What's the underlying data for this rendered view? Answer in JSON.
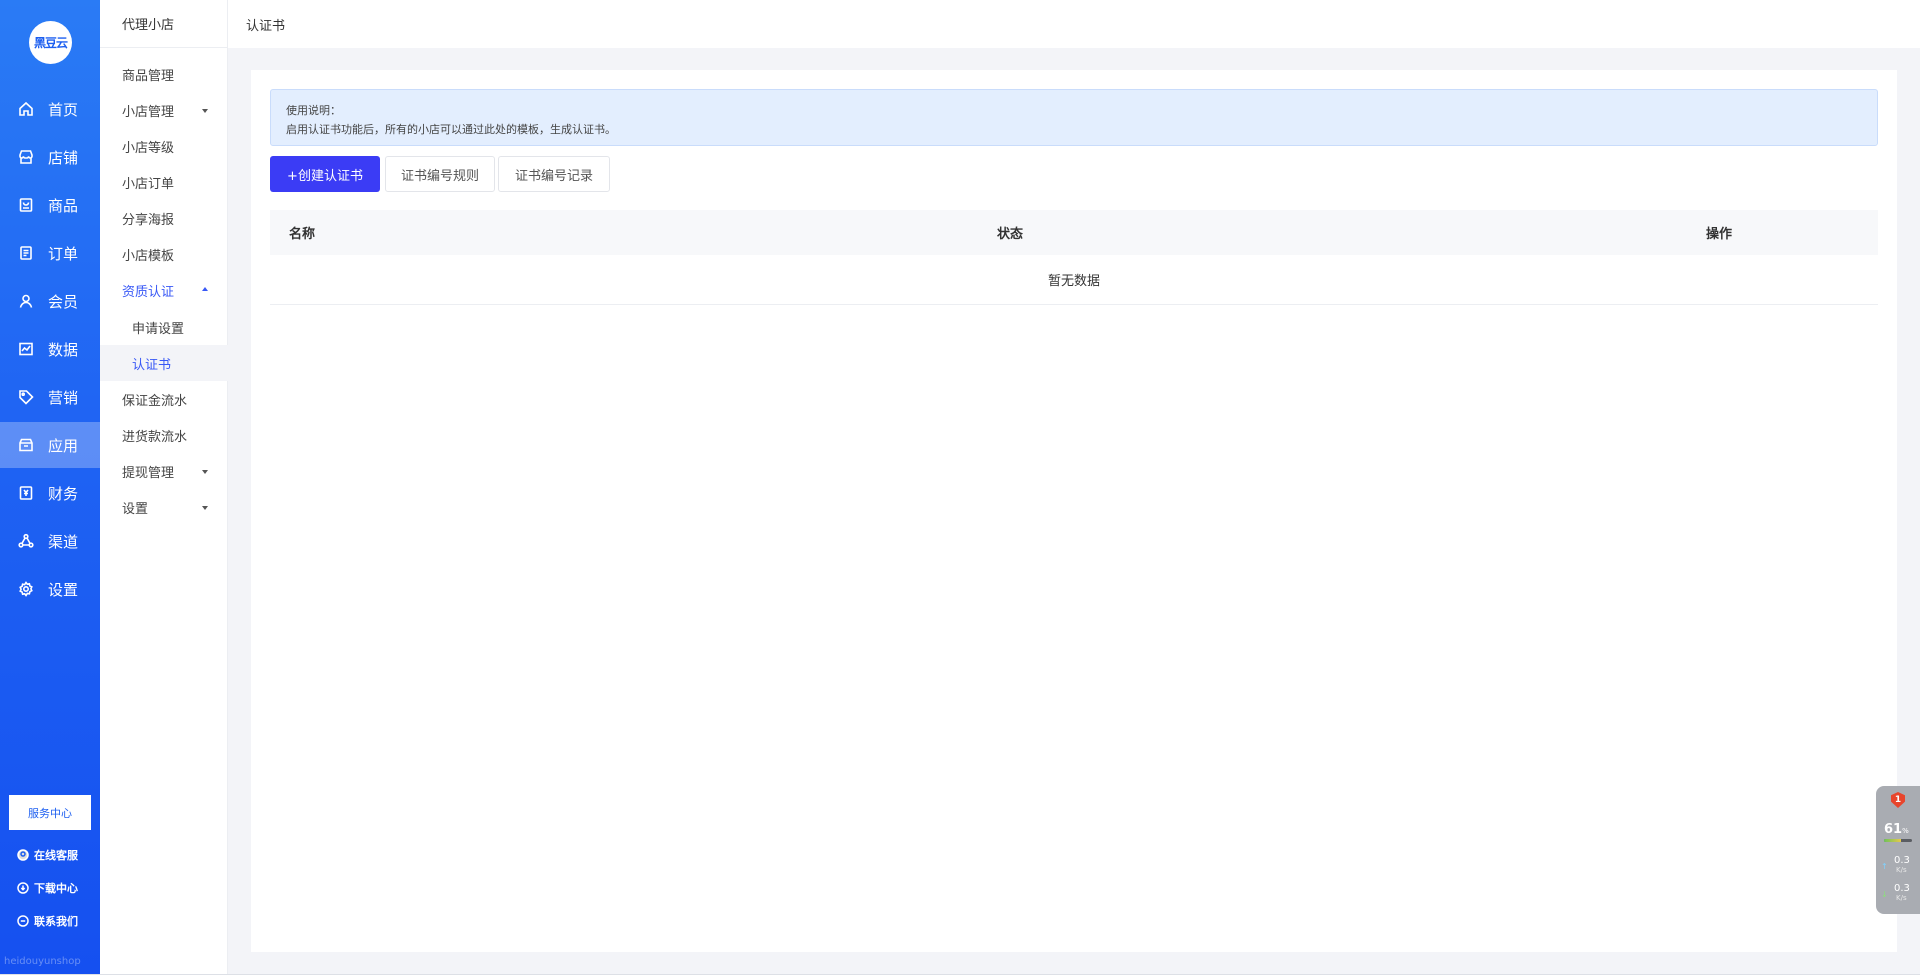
{
  "primary_nav": {
    "logo_text": "黑豆云",
    "items": [
      {
        "label": "首页",
        "icon": "home-icon"
      },
      {
        "label": "店铺",
        "icon": "shop-icon"
      },
      {
        "label": "商品",
        "icon": "goods-icon"
      },
      {
        "label": "订单",
        "icon": "order-icon"
      },
      {
        "label": "会员",
        "icon": "member-icon"
      },
      {
        "label": "数据",
        "icon": "chart-icon"
      },
      {
        "label": "营销",
        "icon": "tag-icon"
      },
      {
        "label": "应用",
        "icon": "app-icon"
      },
      {
        "label": "财务",
        "icon": "finance-icon"
      },
      {
        "label": "渠道",
        "icon": "channel-icon"
      },
      {
        "label": "设置",
        "icon": "settings-icon"
      }
    ],
    "active": "应用",
    "service_center": "服务中心",
    "footer_links": [
      "在线客服",
      "下载中心",
      "联系我们"
    ],
    "watermark": "heidouyunshop"
  },
  "secondary_nav": {
    "title": "代理小店",
    "items": [
      {
        "label": "商品管理"
      },
      {
        "label": "小店管理",
        "caret": "down"
      },
      {
        "label": "小店等级"
      },
      {
        "label": "小店订单"
      },
      {
        "label": "分享海报"
      },
      {
        "label": "小店模板"
      },
      {
        "label": "资质认证",
        "caret": "up",
        "state": "open"
      },
      {
        "label": "申请设置",
        "sub": true
      },
      {
        "label": "认证书",
        "sub": true,
        "state": "current"
      },
      {
        "label": "保证金流水"
      },
      {
        "label": "进货款流水"
      },
      {
        "label": "提现管理",
        "caret": "down"
      },
      {
        "label": "设置",
        "caret": "down"
      }
    ]
  },
  "header": {
    "breadcrumb": "认证书"
  },
  "notice": {
    "title": "使用说明：",
    "body": "启用认证书功能后，所有的小店可以通过此处的模板，生成认证书。"
  },
  "toolbar": {
    "create_label": "+创建认证书",
    "rule_label": "证书编号规则",
    "record_label": "证书编号记录"
  },
  "table": {
    "columns": [
      "名称",
      "状态",
      "操作"
    ],
    "empty_text": "暂无数据"
  },
  "monitor": {
    "badge": "1",
    "percent": "61",
    "percent_unit": "%",
    "usage_fraction": 0.61,
    "upload_rate": "0.3",
    "download_rate": "0.3",
    "rate_unit": "K/s",
    "colors": {
      "badge": "#e8452c",
      "bar_start": "#6ec35a",
      "bar_end": "#e6c94b"
    }
  },
  "colors": {
    "sidebar_top": "#2a7bf5",
    "sidebar_bottom": "#1550f0",
    "accent": "#3858f6",
    "primary_button": "#3b3cf5",
    "notice_bg": "#e3eefe"
  }
}
